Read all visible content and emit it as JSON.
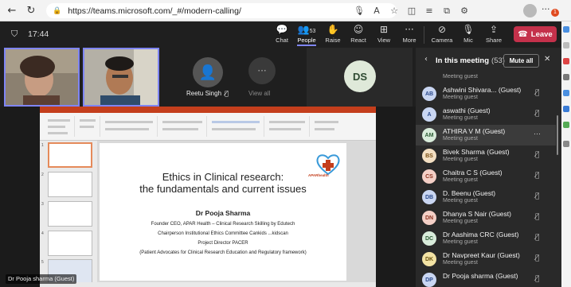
{
  "browser": {
    "url": "https://teams.microsoft.com/_#/modern-calling/",
    "notif_count": "1"
  },
  "teams": {
    "timer": "17:44",
    "toolbar": {
      "chat": "Chat",
      "people": "People",
      "people_count": "53",
      "raise": "Raise",
      "react": "React",
      "view": "View",
      "more": "More",
      "camera": "Camera",
      "mic": "Mic",
      "share": "Share",
      "leave": "Leave"
    }
  },
  "tiles": {
    "reetu_name": "Reetu Singh",
    "view_all": "View all",
    "ds_initials": "DS"
  },
  "slide": {
    "title_line1": "Ethics in Clinical research:",
    "title_line2": "the fundamentals and current issues",
    "presenter": "Dr Pooja Sharma",
    "line1": "Founder CEO, APAR Health – Clinical Research Skilling by Edutech",
    "line2": "Chairperson Institutional Ethics Committee Cankids ...kidscan",
    "line3": "Project Director PACER",
    "line4": "(Patient Advocates for Clinical Research Education and Regulatory framework)",
    "logo_text": "APARhealth"
  },
  "presenter_label": "Dr Pooja sharma (Guest)",
  "panel": {
    "title": "In this meeting",
    "count": "(53)",
    "mute_all": "Mute all",
    "partial_sub": "Meeting guest",
    "participants": [
      {
        "initials": "AB",
        "name": "Ashwini Shivara...  (Guest)",
        "sub": "Meeting guest",
        "color": "#c9d6f2",
        "text_color": "#2b4a8c"
      },
      {
        "initials": "A",
        "name": "aswathi (Guest)",
        "sub": "Meeting guest",
        "color": "#c9d6f2",
        "text_color": "#2b4a8c"
      },
      {
        "initials": "AM",
        "name": "ATHIRA V M (Guest)",
        "sub": "Meeting guest",
        "color": "#d9ecdb",
        "text_color": "#2f5e37"
      },
      {
        "initials": "BS",
        "name": "Bivek Sharma (Guest)",
        "sub": "Meeting guest",
        "color": "#f3dfc2",
        "text_color": "#7a4e15"
      },
      {
        "initials": "CS",
        "name": "Chaitra C S (Guest)",
        "sub": "Meeting guest",
        "color": "#f4cfc6",
        "text_color": "#8c3320"
      },
      {
        "initials": "DB",
        "name": "D. Beenu (Guest)",
        "sub": "Meeting guest",
        "color": "#c9d6f2",
        "text_color": "#2b4a8c"
      },
      {
        "initials": "DN",
        "name": "Dhanya S Nair (Guest)",
        "sub": "Meeting guest",
        "color": "#f4cfc6",
        "text_color": "#8c3320"
      },
      {
        "initials": "DC",
        "name": "Dr Aashima CRC (Guest)",
        "sub": "Meeting guest",
        "color": "#d9ecdb",
        "text_color": "#2f5e37"
      },
      {
        "initials": "DK",
        "name": "Dr Navpreet Kaur (Guest)",
        "sub": "Meeting guest",
        "color": "#f3e3a4",
        "text_color": "#6b5410"
      },
      {
        "initials": "DP",
        "name": "Dr Pooja sharma (Guest)",
        "sub": "",
        "color": "#c9d6f2",
        "text_color": "#2b4a8c"
      }
    ]
  }
}
